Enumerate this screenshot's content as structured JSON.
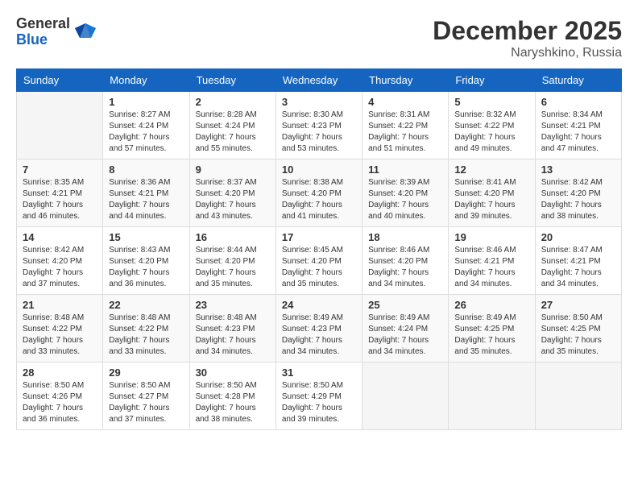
{
  "logo": {
    "general": "General",
    "blue": "Blue"
  },
  "title": {
    "month": "December 2025",
    "location": "Naryshkino, Russia"
  },
  "headers": [
    "Sunday",
    "Monday",
    "Tuesday",
    "Wednesday",
    "Thursday",
    "Friday",
    "Saturday"
  ],
  "weeks": [
    [
      {
        "day": "",
        "sunrise": "",
        "sunset": "",
        "daylight": ""
      },
      {
        "day": "1",
        "sunrise": "Sunrise: 8:27 AM",
        "sunset": "Sunset: 4:24 PM",
        "daylight": "Daylight: 7 hours and 57 minutes."
      },
      {
        "day": "2",
        "sunrise": "Sunrise: 8:28 AM",
        "sunset": "Sunset: 4:24 PM",
        "daylight": "Daylight: 7 hours and 55 minutes."
      },
      {
        "day": "3",
        "sunrise": "Sunrise: 8:30 AM",
        "sunset": "Sunset: 4:23 PM",
        "daylight": "Daylight: 7 hours and 53 minutes."
      },
      {
        "day": "4",
        "sunrise": "Sunrise: 8:31 AM",
        "sunset": "Sunset: 4:22 PM",
        "daylight": "Daylight: 7 hours and 51 minutes."
      },
      {
        "day": "5",
        "sunrise": "Sunrise: 8:32 AM",
        "sunset": "Sunset: 4:22 PM",
        "daylight": "Daylight: 7 hours and 49 minutes."
      },
      {
        "day": "6",
        "sunrise": "Sunrise: 8:34 AM",
        "sunset": "Sunset: 4:21 PM",
        "daylight": "Daylight: 7 hours and 47 minutes."
      }
    ],
    [
      {
        "day": "7",
        "sunrise": "Sunrise: 8:35 AM",
        "sunset": "Sunset: 4:21 PM",
        "daylight": "Daylight: 7 hours and 46 minutes."
      },
      {
        "day": "8",
        "sunrise": "Sunrise: 8:36 AM",
        "sunset": "Sunset: 4:21 PM",
        "daylight": "Daylight: 7 hours and 44 minutes."
      },
      {
        "day": "9",
        "sunrise": "Sunrise: 8:37 AM",
        "sunset": "Sunset: 4:20 PM",
        "daylight": "Daylight: 7 hours and 43 minutes."
      },
      {
        "day": "10",
        "sunrise": "Sunrise: 8:38 AM",
        "sunset": "Sunset: 4:20 PM",
        "daylight": "Daylight: 7 hours and 41 minutes."
      },
      {
        "day": "11",
        "sunrise": "Sunrise: 8:39 AM",
        "sunset": "Sunset: 4:20 PM",
        "daylight": "Daylight: 7 hours and 40 minutes."
      },
      {
        "day": "12",
        "sunrise": "Sunrise: 8:41 AM",
        "sunset": "Sunset: 4:20 PM",
        "daylight": "Daylight: 7 hours and 39 minutes."
      },
      {
        "day": "13",
        "sunrise": "Sunrise: 8:42 AM",
        "sunset": "Sunset: 4:20 PM",
        "daylight": "Daylight: 7 hours and 38 minutes."
      }
    ],
    [
      {
        "day": "14",
        "sunrise": "Sunrise: 8:42 AM",
        "sunset": "Sunset: 4:20 PM",
        "daylight": "Daylight: 7 hours and 37 minutes."
      },
      {
        "day": "15",
        "sunrise": "Sunrise: 8:43 AM",
        "sunset": "Sunset: 4:20 PM",
        "daylight": "Daylight: 7 hours and 36 minutes."
      },
      {
        "day": "16",
        "sunrise": "Sunrise: 8:44 AM",
        "sunset": "Sunset: 4:20 PM",
        "daylight": "Daylight: 7 hours and 35 minutes."
      },
      {
        "day": "17",
        "sunrise": "Sunrise: 8:45 AM",
        "sunset": "Sunset: 4:20 PM",
        "daylight": "Daylight: 7 hours and 35 minutes."
      },
      {
        "day": "18",
        "sunrise": "Sunrise: 8:46 AM",
        "sunset": "Sunset: 4:20 PM",
        "daylight": "Daylight: 7 hours and 34 minutes."
      },
      {
        "day": "19",
        "sunrise": "Sunrise: 8:46 AM",
        "sunset": "Sunset: 4:21 PM",
        "daylight": "Daylight: 7 hours and 34 minutes."
      },
      {
        "day": "20",
        "sunrise": "Sunrise: 8:47 AM",
        "sunset": "Sunset: 4:21 PM",
        "daylight": "Daylight: 7 hours and 34 minutes."
      }
    ],
    [
      {
        "day": "21",
        "sunrise": "Sunrise: 8:48 AM",
        "sunset": "Sunset: 4:22 PM",
        "daylight": "Daylight: 7 hours and 33 minutes."
      },
      {
        "day": "22",
        "sunrise": "Sunrise: 8:48 AM",
        "sunset": "Sunset: 4:22 PM",
        "daylight": "Daylight: 7 hours and 33 minutes."
      },
      {
        "day": "23",
        "sunrise": "Sunrise: 8:48 AM",
        "sunset": "Sunset: 4:23 PM",
        "daylight": "Daylight: 7 hours and 34 minutes."
      },
      {
        "day": "24",
        "sunrise": "Sunrise: 8:49 AM",
        "sunset": "Sunset: 4:23 PM",
        "daylight": "Daylight: 7 hours and 34 minutes."
      },
      {
        "day": "25",
        "sunrise": "Sunrise: 8:49 AM",
        "sunset": "Sunset: 4:24 PM",
        "daylight": "Daylight: 7 hours and 34 minutes."
      },
      {
        "day": "26",
        "sunrise": "Sunrise: 8:49 AM",
        "sunset": "Sunset: 4:25 PM",
        "daylight": "Daylight: 7 hours and 35 minutes."
      },
      {
        "day": "27",
        "sunrise": "Sunrise: 8:50 AM",
        "sunset": "Sunset: 4:25 PM",
        "daylight": "Daylight: 7 hours and 35 minutes."
      }
    ],
    [
      {
        "day": "28",
        "sunrise": "Sunrise: 8:50 AM",
        "sunset": "Sunset: 4:26 PM",
        "daylight": "Daylight: 7 hours and 36 minutes."
      },
      {
        "day": "29",
        "sunrise": "Sunrise: 8:50 AM",
        "sunset": "Sunset: 4:27 PM",
        "daylight": "Daylight: 7 hours and 37 minutes."
      },
      {
        "day": "30",
        "sunrise": "Sunrise: 8:50 AM",
        "sunset": "Sunset: 4:28 PM",
        "daylight": "Daylight: 7 hours and 38 minutes."
      },
      {
        "day": "31",
        "sunrise": "Sunrise: 8:50 AM",
        "sunset": "Sunset: 4:29 PM",
        "daylight": "Daylight: 7 hours and 39 minutes."
      },
      {
        "day": "",
        "sunrise": "",
        "sunset": "",
        "daylight": ""
      },
      {
        "day": "",
        "sunrise": "",
        "sunset": "",
        "daylight": ""
      },
      {
        "day": "",
        "sunrise": "",
        "sunset": "",
        "daylight": ""
      }
    ]
  ]
}
